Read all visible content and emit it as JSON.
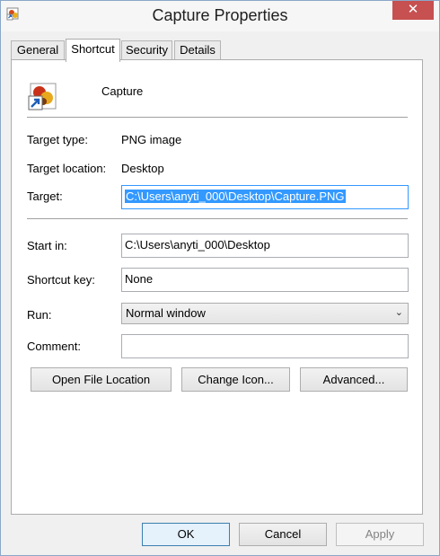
{
  "window": {
    "title": "Capture Properties",
    "close_symbol": "✕"
  },
  "tabs": [
    {
      "label": "General"
    },
    {
      "label": "Shortcut"
    },
    {
      "label": "Security"
    },
    {
      "label": "Details"
    }
  ],
  "active_tab": "Shortcut",
  "shortcut": {
    "name": "Capture",
    "target_type_label": "Target type:",
    "target_type_value": "PNG image",
    "target_location_label": "Target location:",
    "target_location_value": "Desktop",
    "target_label": "Target:",
    "target_value": "C:\\Users\\anyti_000\\Desktop\\Capture.PNG",
    "start_in_label": "Start in:",
    "start_in_value": "C:\\Users\\anyti_000\\Desktop",
    "shortcut_key_label": "Shortcut key:",
    "shortcut_key_value": "None",
    "run_label": "Run:",
    "run_value": "Normal window",
    "comment_label": "Comment:",
    "comment_value": ""
  },
  "actions": {
    "open_file_location": "Open File Location",
    "change_icon": "Change Icon...",
    "advanced": "Advanced..."
  },
  "footer": {
    "ok": "OK",
    "cancel": "Cancel",
    "apply": "Apply"
  },
  "colors": {
    "close_button": "#c75050",
    "selection": "#3399ff"
  },
  "icons": {
    "app": "image-file-icon",
    "shortcut_overlay": "shortcut-arrow-icon",
    "dropdown": "chevron-down-icon"
  }
}
